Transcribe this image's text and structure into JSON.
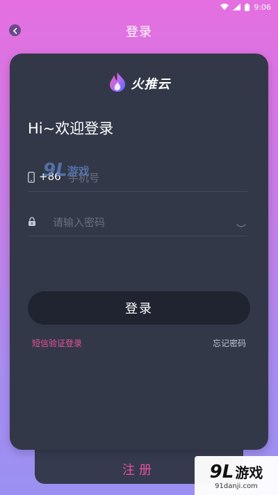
{
  "status_bar": {
    "time": "9:06"
  },
  "header": {
    "title": "登录"
  },
  "card": {
    "app_name": "火推云",
    "greeting": "Hi~欢迎登录",
    "phone": {
      "country_code": "+86",
      "placeholder": "手机号"
    },
    "password": {
      "placeholder": "请输入密码"
    },
    "login_button": "登录",
    "sms_login": "短信验证登录",
    "forgot_password": "忘记密码"
  },
  "register": {
    "label": "注册"
  },
  "watermark": {
    "mark": "9L",
    "text": "游戏",
    "url": "91danji.com"
  },
  "colors": {
    "accent": "#e8519c",
    "card": "#333848",
    "button": "#202431"
  }
}
